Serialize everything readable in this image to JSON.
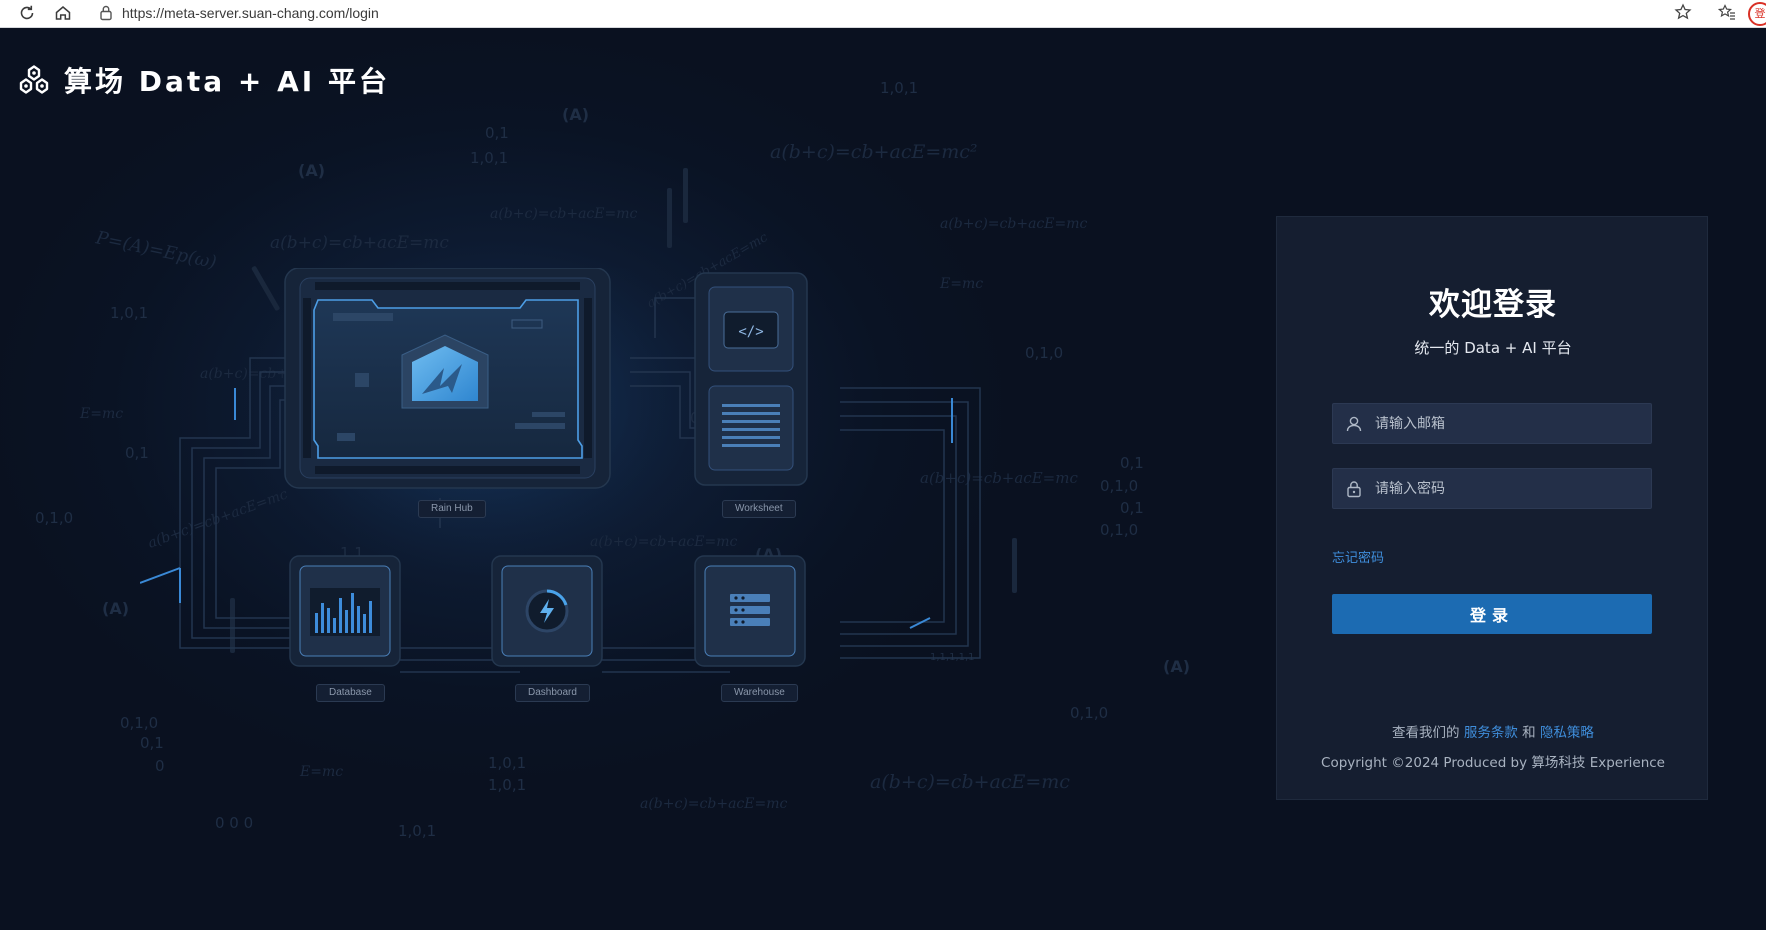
{
  "browser": {
    "url": "https://meta-server.suan-chang.com/login",
    "profile_label": "登"
  },
  "brand": {
    "name": "算场 Data + AI 平台"
  },
  "illustration": {
    "nodes": [
      "Rain Hub",
      "Worksheet",
      "Database",
      "Dashboard",
      "Warehouse"
    ]
  },
  "login": {
    "title": "欢迎登录",
    "subtitle": "统一的 Data + AI 平台",
    "email_placeholder": "请输入邮箱",
    "password_placeholder": "请输入密码",
    "forgot_password": "忘记密码",
    "submit_label": "登录",
    "terms_prefix": "查看我们的",
    "terms_link": "服务条款",
    "terms_and": "和",
    "privacy_link": "隐私策略",
    "copyright": "Copyright ©2024 Produced by 算场科技 Experience"
  },
  "colors": {
    "background": "#0a1120",
    "card": "#151e30",
    "input": "#232f48",
    "primary_button": "#1c6bb2",
    "link": "#3f8edb"
  }
}
